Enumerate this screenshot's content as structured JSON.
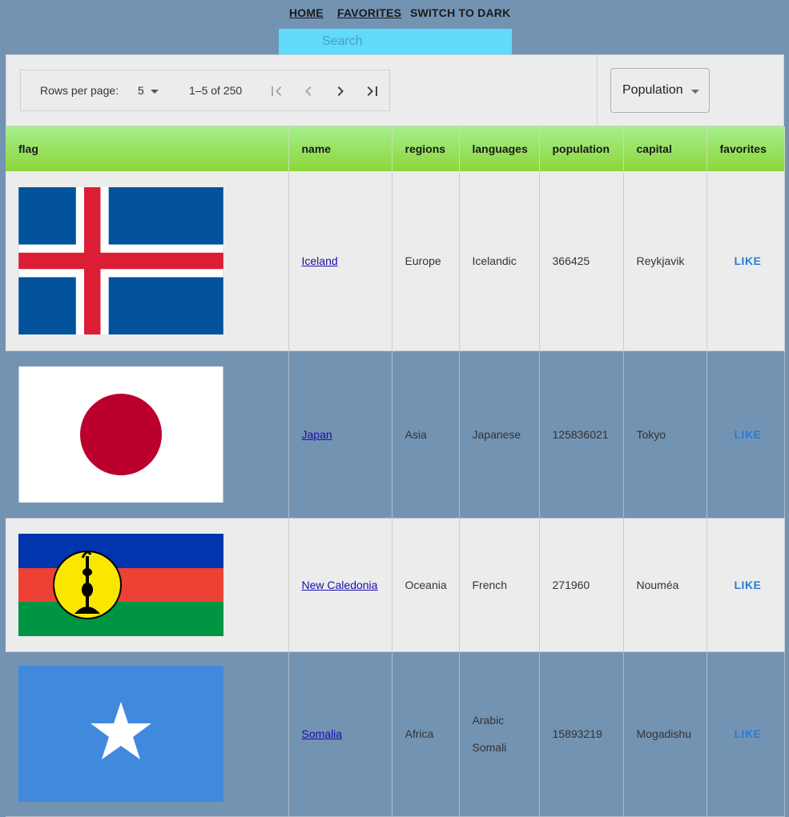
{
  "nav": {
    "home": "HOME",
    "favorites": "FAVORITES",
    "theme_toggle": "SWITCH TO DARK"
  },
  "search": {
    "placeholder": "Search"
  },
  "pager": {
    "rows_label": "Rows per page:",
    "rows_value": "5",
    "range": "1–5 of 250"
  },
  "sort": {
    "selected": "Population"
  },
  "table": {
    "headers": [
      "flag",
      "name",
      "regions",
      "languages",
      "population",
      "capital",
      "favorites"
    ],
    "rows": [
      {
        "flag": "iceland-flag",
        "name": "Iceland",
        "region": "Europe",
        "languages": [
          "Icelandic"
        ],
        "population": "366425",
        "capital": "Reykjavik",
        "action": "LIKE"
      },
      {
        "flag": "japan-flag",
        "name": "Japan",
        "region": "Asia",
        "languages": [
          "Japanese"
        ],
        "population": "125836021",
        "capital": "Tokyo",
        "action": "LIKE"
      },
      {
        "flag": "new-caledonia-flag",
        "name": "New Caledonia",
        "region": "Oceania",
        "languages": [
          "French"
        ],
        "population": "271960",
        "capital": "Nouméa",
        "action": "LIKE"
      },
      {
        "flag": "somalia-flag",
        "name": "Somalia",
        "region": "Africa",
        "languages": [
          "Arabic",
          "Somali"
        ],
        "population": "15893219",
        "capital": "Mogadishu",
        "action": "LIKE"
      }
    ]
  },
  "colors": {
    "background": "#7393b3",
    "search_bg": "#61dafb",
    "header_green": "#8cd63a",
    "link": "#1a0dab",
    "like": "#2a7cd3"
  }
}
